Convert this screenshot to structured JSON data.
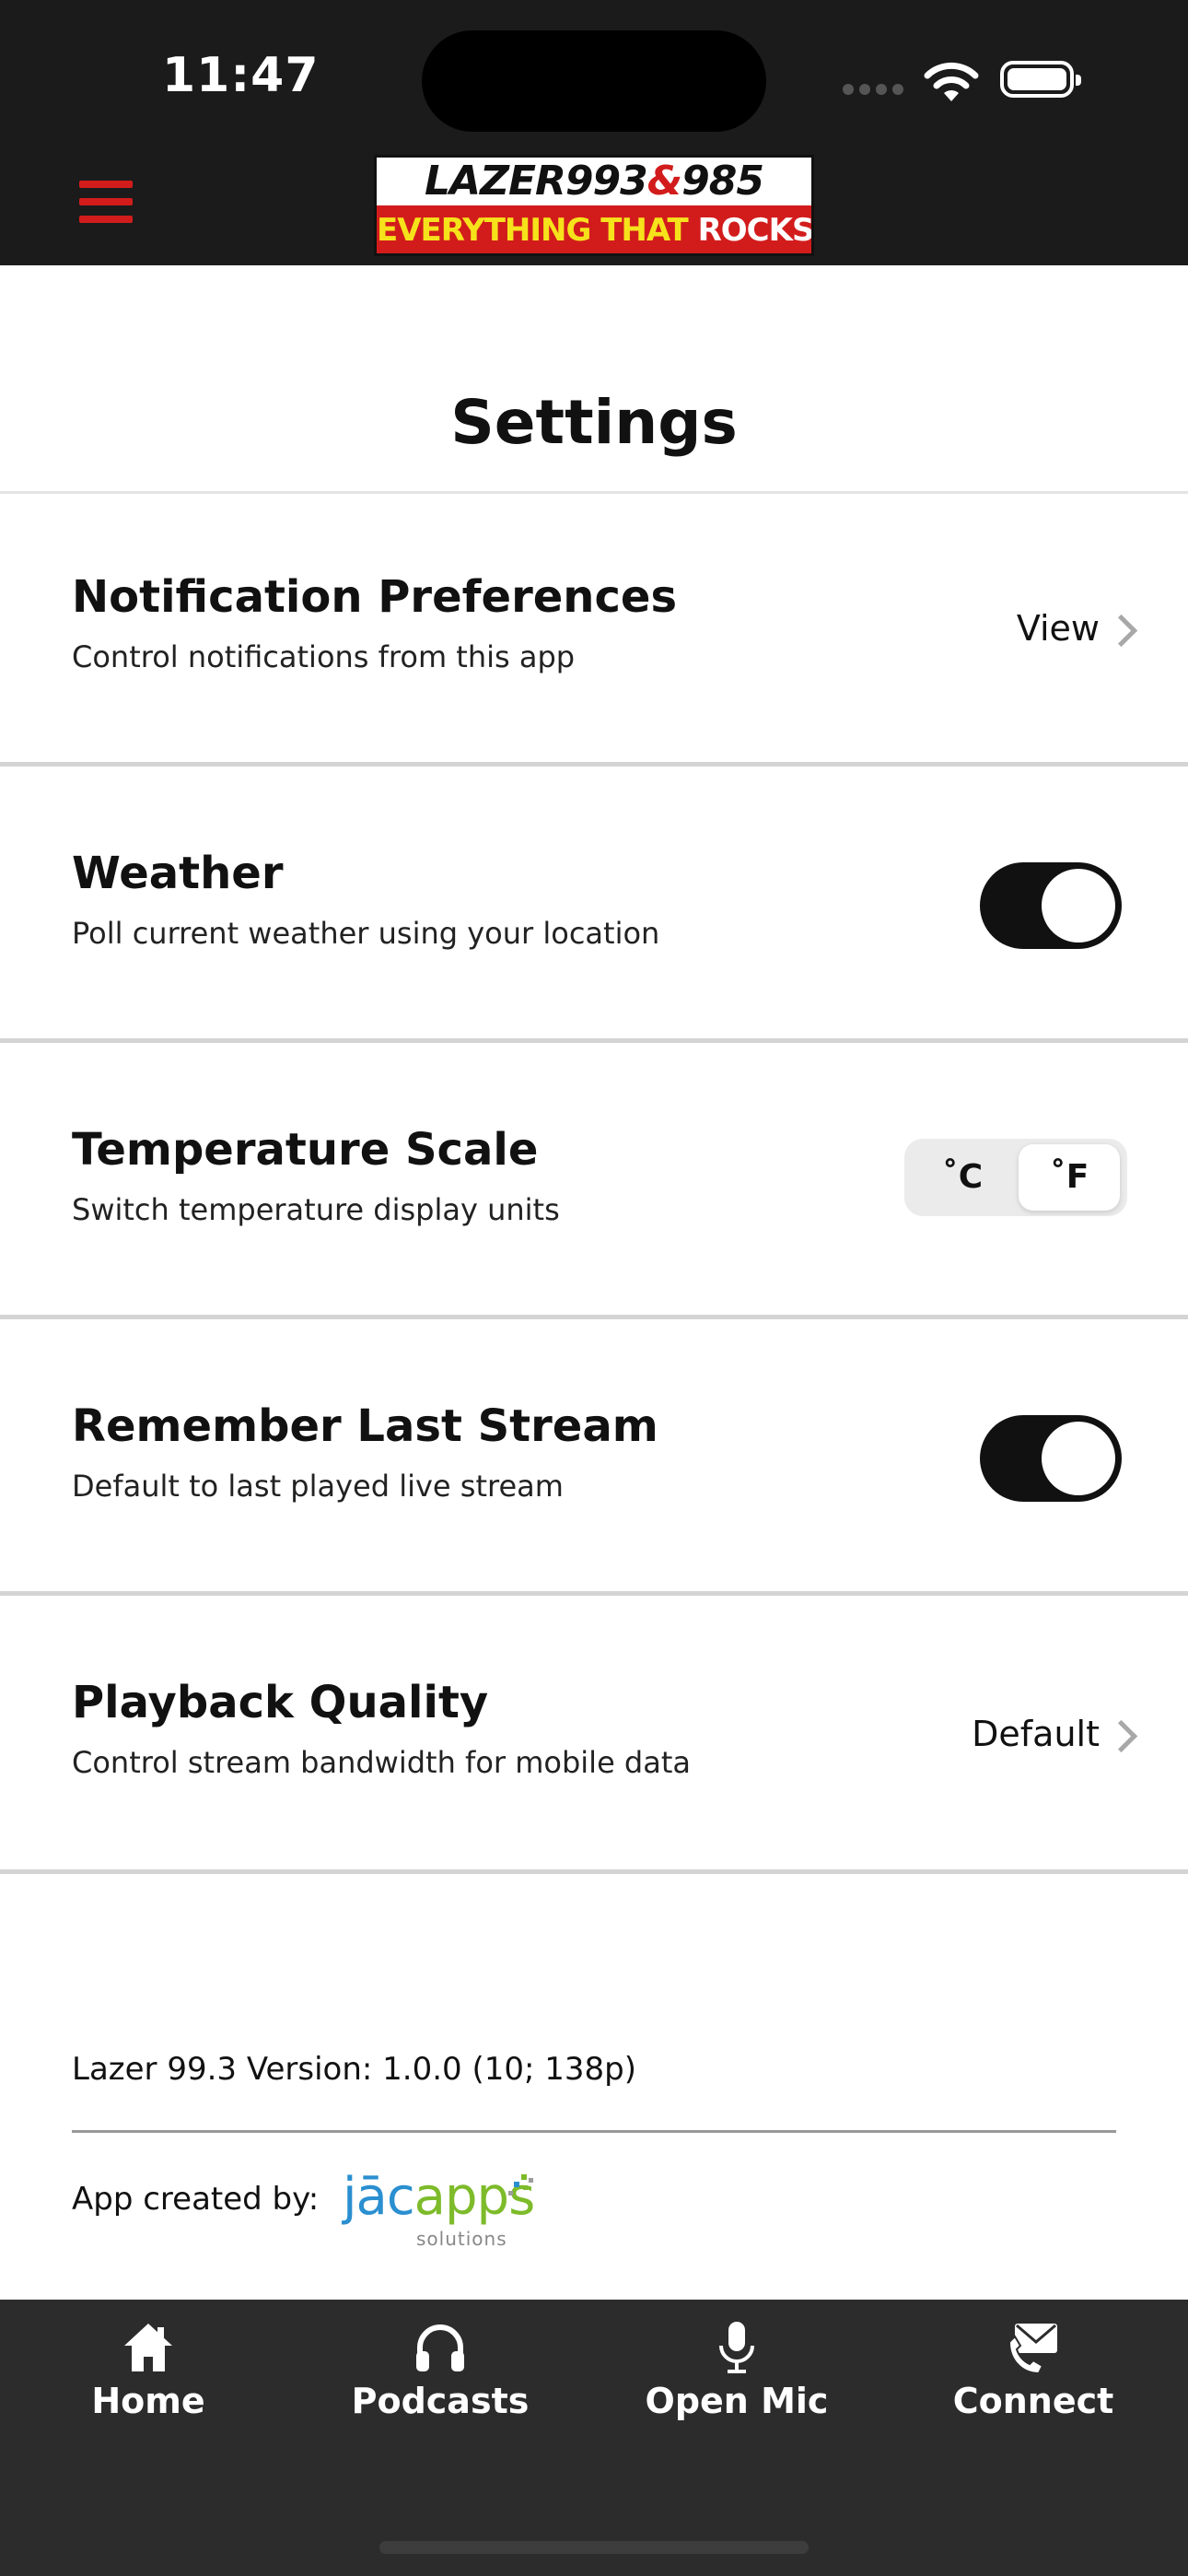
{
  "status_bar": {
    "time": "11:47"
  },
  "header": {
    "logo_line1": "LAZER993",
    "logo_amp": "&",
    "logo_line1b": "985",
    "logo_line2": "EVERYTHING THAT ",
    "logo_line2b": "ROCKS!"
  },
  "page": {
    "title": "Settings"
  },
  "settings": {
    "notifications": {
      "title": "Notification Preferences",
      "subtitle": "Control notifications from this app",
      "action": "View"
    },
    "weather": {
      "title": "Weather",
      "subtitle": "Poll current weather using your location",
      "enabled": true
    },
    "temperature": {
      "title": "Temperature Scale",
      "subtitle": "Switch temperature display units",
      "option_c": "˚C",
      "option_f": "˚F",
      "selected": "˚F"
    },
    "remember_stream": {
      "title": "Remember Last Stream",
      "subtitle": "Default to last played live stream",
      "enabled": true
    },
    "playback": {
      "title": "Playback Quality",
      "subtitle": "Control stream bandwidth for mobile data",
      "action": "Default"
    }
  },
  "footer": {
    "version": "Lazer 99.3 Version: 1.0.0 (10; 138p)",
    "created_by": "App created by:",
    "brand_jac": "jāc",
    "brand_apps": "apps",
    "brand_sub": "solutions"
  },
  "tabbar": {
    "tabs": [
      {
        "label": "Home",
        "icon": "home-icon"
      },
      {
        "label": "Podcasts",
        "icon": "headphones-icon"
      },
      {
        "label": "Open Mic",
        "icon": "microphone-icon"
      },
      {
        "label": "Connect",
        "icon": "mail-phone-icon"
      }
    ]
  },
  "colors": {
    "accent": "#d21c1c",
    "header_bg": "#1b1b1b",
    "tabbar_bg": "#2c2c2c",
    "toggle_on": "#111111"
  }
}
